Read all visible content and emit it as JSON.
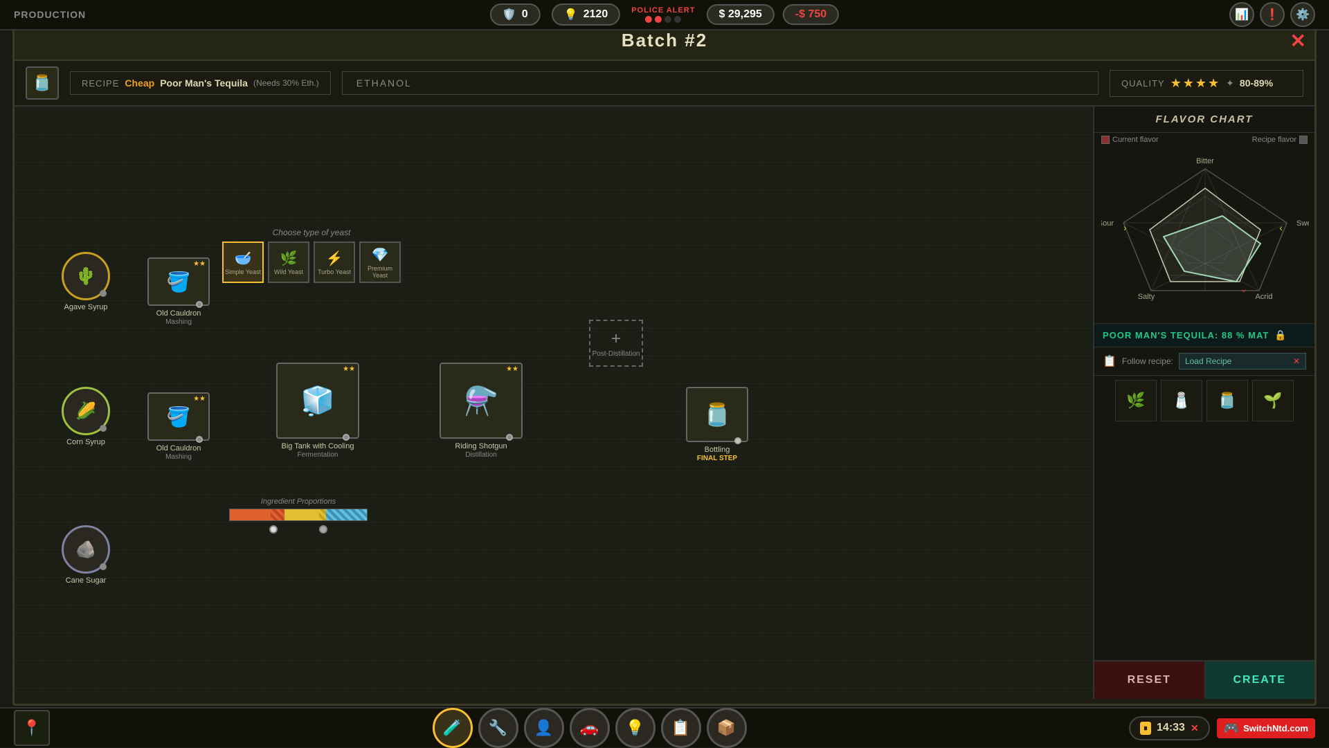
{
  "topbar": {
    "production_label": "PRODUCTION",
    "health_stat": "0",
    "energy_stat": "2120",
    "police_alert": "POLICE ALERT",
    "money": "$ 29,295",
    "money_neg": "-$ 750"
  },
  "modal": {
    "title": "Batch #2",
    "close_label": "✕"
  },
  "recipe": {
    "label": "RECIPE",
    "cheap_label": "Cheap",
    "name": "Poor Man's Tequila",
    "needs": "(Needs 30% Eth.)",
    "ethanol": "ETHANOL",
    "quality_label": "QUALITY",
    "quality_pct": "80-89%"
  },
  "flavor_chart": {
    "title": "FLAVOR CHART",
    "current_label": "Current flavor",
    "recipe_label": "Recipe flavor",
    "labels": {
      "bitter": "Bitter",
      "sweet": "Sweet",
      "acrid": "Acrid",
      "salty": "Salty",
      "sour": "Sour"
    },
    "match_text": "POOR MAN'S TEQUILA: 88 % MAT"
  },
  "nodes": {
    "agave_syrup": {
      "label": "Agave Syrup",
      "icon": "🌵"
    },
    "corn_syrup": {
      "label": "Corn Syrup",
      "icon": "🌽"
    },
    "cane_sugar": {
      "label": "Cane Sugar",
      "icon": "🪨"
    },
    "mashing1": {
      "label": "Old Cauldron",
      "sublabel": "Mashing",
      "icon": "🪣"
    },
    "mashing2": {
      "label": "Old Cauldron",
      "sublabel": "Mashing",
      "icon": "🪣"
    },
    "fermentation": {
      "label": "Big Tank with Cooling",
      "sublabel": "Fermentation",
      "icon": "🧊"
    },
    "distillation": {
      "label": "Riding Shotgun",
      "sublabel": "Distillation",
      "icon": "⚗️"
    },
    "bottling": {
      "label": "Bottling",
      "sublabel": "FINAL STEP",
      "icon": "🫙"
    },
    "post_distillation": {
      "label": "Post-Distillation",
      "plus": "+"
    }
  },
  "yeast": {
    "choose_label": "Choose type of yeast",
    "options": [
      {
        "name": "Simple Yeast",
        "icon": "🥣",
        "selected": true
      },
      {
        "name": "Wild Yeast",
        "icon": "🫙"
      },
      {
        "name": "Turbo Yeast",
        "icon": "🧪"
      },
      {
        "name": "Premium Yeast",
        "icon": "🫙"
      }
    ]
  },
  "proportions": {
    "label": "Ingredient Proportions"
  },
  "follow_recipe": {
    "label": "Follow recipe:",
    "button": "Load Recipe"
  },
  "buttons": {
    "reset": "RESET",
    "create": "CREATE"
  },
  "taskbar": {
    "icons": [
      "🧪",
      "🔧",
      "👤",
      "🚗",
      "💡",
      "📋",
      "📦"
    ]
  },
  "timer": {
    "value": "14:33"
  },
  "nintendo": {
    "label": "SwitchNtd.com"
  }
}
